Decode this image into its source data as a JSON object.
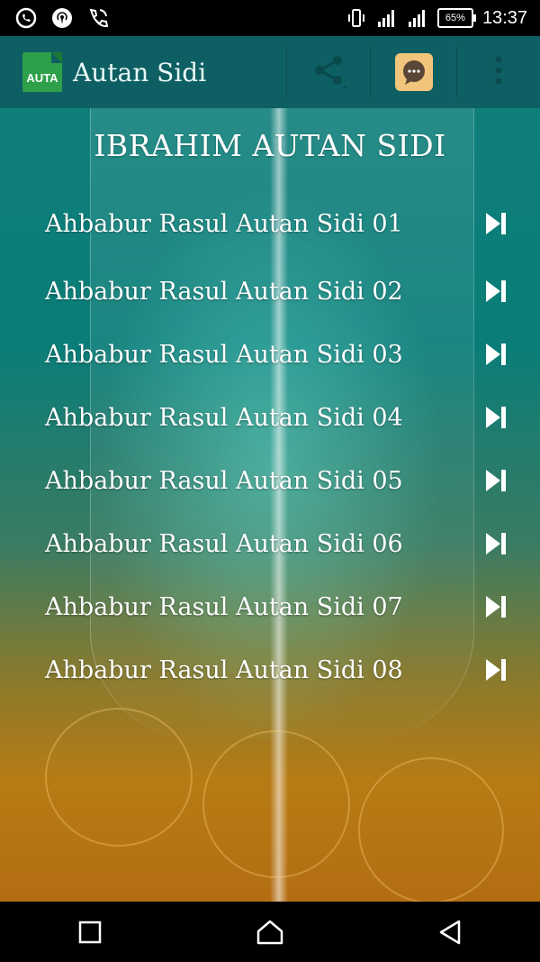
{
  "status_bar": {
    "time": "13:37",
    "battery": "65%",
    "left_icons": [
      "whatsapp-icon",
      "hotspot-icon",
      "phone-call-icon"
    ],
    "right_icons": [
      "vibrate-icon",
      "signal-icon",
      "signal-icon"
    ]
  },
  "app_bar": {
    "logo_text": "AUTA",
    "title": "Autan Sidi",
    "actions": [
      "share-icon",
      "chat-icon",
      "overflow-menu-icon"
    ]
  },
  "main": {
    "heading": "IBRAHIM AUTAN SIDI",
    "tracks": [
      {
        "label": "Ahbabur Rasul Autan Sidi 01"
      },
      {
        "label": "Ahbabur Rasul Autan Sidi 02"
      },
      {
        "label": "Ahbabur Rasul Autan Sidi 03"
      },
      {
        "label": "Ahbabur Rasul Autan Sidi 04"
      },
      {
        "label": "Ahbabur Rasul Autan Sidi 05"
      },
      {
        "label": "Ahbabur Rasul Autan Sidi 06"
      },
      {
        "label": "Ahbabur Rasul Autan Sidi 07"
      },
      {
        "label": "Ahbabur Rasul Autan Sidi 08"
      }
    ]
  },
  "nav_bar": {
    "buttons": [
      "recent-apps-icon",
      "home-icon",
      "back-icon"
    ]
  },
  "colors": {
    "app_bar": "#0e5f63",
    "logo_bg": "#2ea04a",
    "chat_tile": "#f1c57b",
    "text": "#ffffff"
  }
}
